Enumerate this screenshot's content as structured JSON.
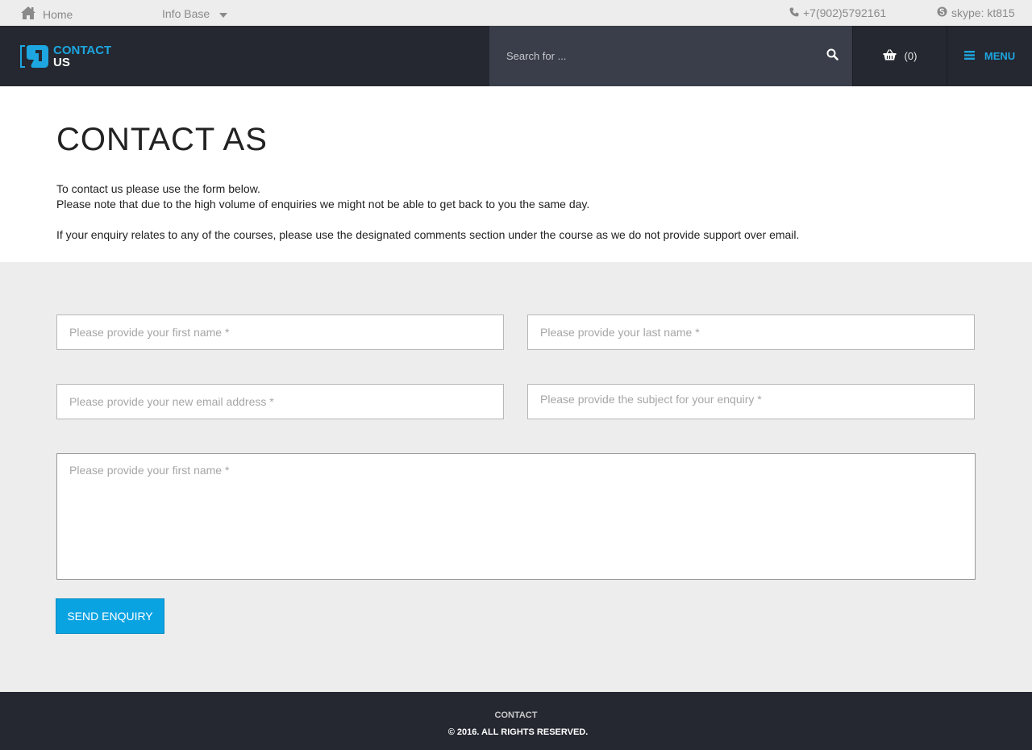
{
  "topbar": {
    "home_label": "Home",
    "infobase_label": "Info Base",
    "phone": "+7(902)5792161",
    "skype": "skype: kt815"
  },
  "header": {
    "logo_line1": "CONTACT",
    "logo_line2": "US",
    "search_placeholder": "Search for ...",
    "cart_count": "(0)",
    "menu_label": "MENU"
  },
  "intro": {
    "title": "CONTACT AS",
    "line1": "To contact us please use the form below.",
    "line2": "Please note that due to the high volume of enquiries we might not be able to get back to you the same day.",
    "line3": "If your enquiry relates to any of the courses, please use the designated comments section under the course as we do not provide support over email."
  },
  "form": {
    "first_name_placeholder": "Please provide your first name *",
    "last_name_placeholder": "Please provide your last name *",
    "email_placeholder": "Please provide your new email address *",
    "subject_placeholder": "Please provide the subject for your enquiry *",
    "message_placeholder": "Please provide your first name *",
    "send_label": "SEND ENQUIRY"
  },
  "footer": {
    "link": "CONTACT",
    "copyright": "© 2016. ALL RIGHTS RESERVED."
  },
  "colors": {
    "accent": "#0aa3e2",
    "header_bg": "#252831",
    "search_bg": "#3a3e4a",
    "form_bg": "#ededed"
  },
  "icons": [
    "home-icon",
    "caret-down-icon",
    "phone-icon",
    "skype-icon",
    "search-icon",
    "basket-icon",
    "menu-icon",
    "logo-icon"
  ]
}
